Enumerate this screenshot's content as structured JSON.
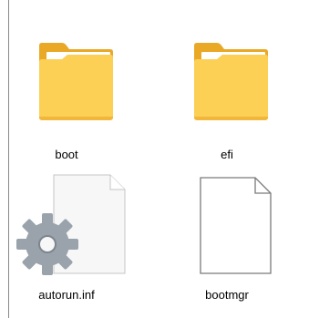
{
  "window": {
    "view_mode": "Large icons"
  },
  "items": [
    {
      "name": "boot",
      "type": "folder",
      "icon": "folder-icon"
    },
    {
      "name": "efi",
      "type": "folder",
      "icon": "folder-icon"
    },
    {
      "name": "autorun.inf",
      "type": "file",
      "icon": "settings-file-icon"
    },
    {
      "name": "bootmgr",
      "type": "file",
      "icon": "blank-file-icon"
    }
  ],
  "colors": {
    "folder_back": "#e9a826",
    "folder_front": "#fccf55",
    "page_fill": "#f7f7f7",
    "gear": "#9aa3ab"
  }
}
